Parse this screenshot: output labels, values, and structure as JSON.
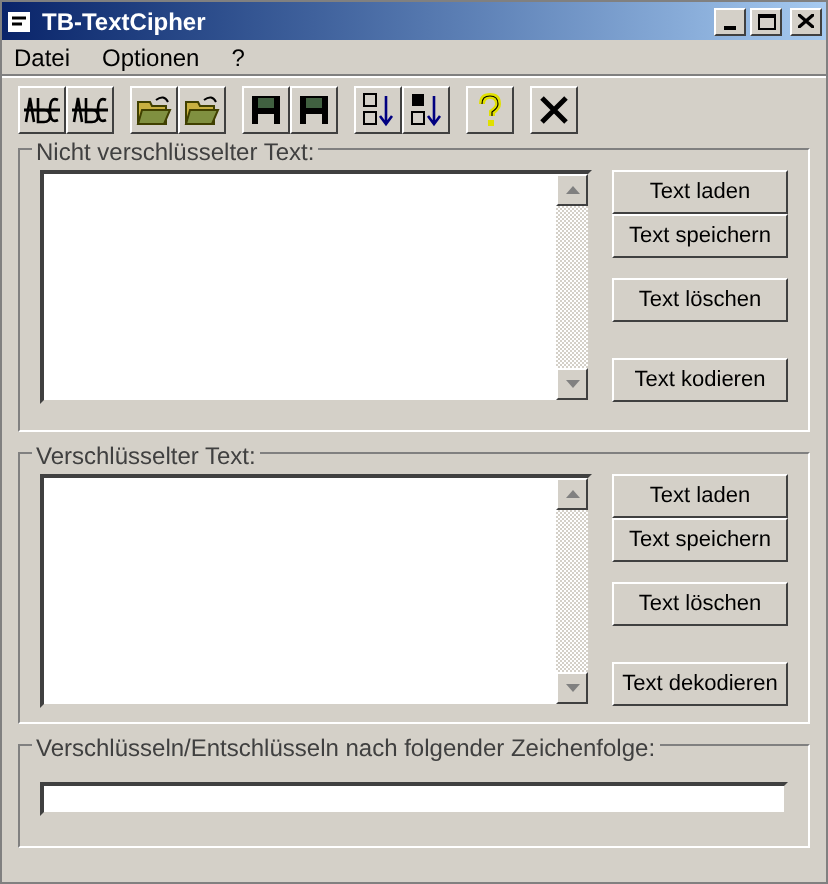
{
  "window": {
    "title": "TB-TextCipher"
  },
  "menu": [
    "Datei",
    "Optionen",
    "?"
  ],
  "toolbar": [
    [
      {
        "kind": "spell"
      },
      {
        "kind": "spell"
      }
    ],
    [
      {
        "kind": "open"
      },
      {
        "kind": "open"
      }
    ],
    [
      {
        "kind": "save"
      },
      {
        "kind": "save"
      }
    ],
    [
      {
        "kind": "sort_asc"
      },
      {
        "kind": "sort_desc"
      }
    ],
    [
      {
        "kind": "help"
      }
    ],
    [
      {
        "kind": "exit"
      }
    ]
  ],
  "plain_group": {
    "label": "Nicht verschlüsselter Text:",
    "buttons": [
      "Text laden",
      "Text speichern",
      "Text löschen",
      "Text kodieren"
    ]
  },
  "cipher_group": {
    "label": "Verschlüsselter Text:",
    "buttons": [
      "Text laden",
      "Text speichern",
      "Text löschen",
      "Text dekodieren"
    ]
  },
  "key_group": {
    "label": "Verschlüsseln/Entschlüsseln nach folgender Zeichenfolge:"
  }
}
